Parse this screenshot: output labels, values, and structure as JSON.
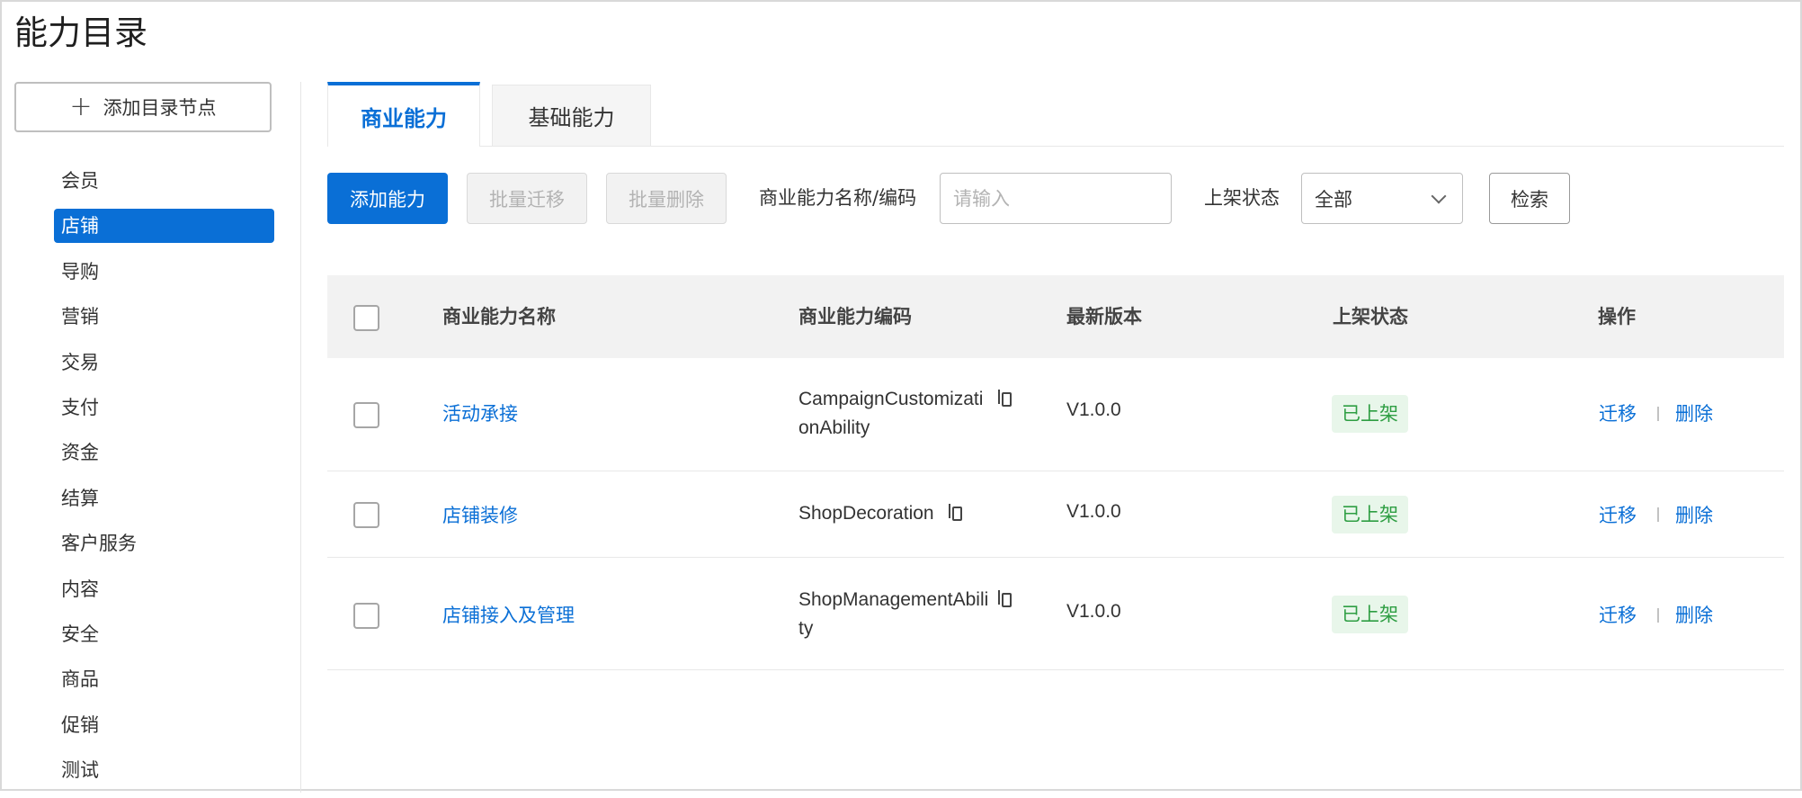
{
  "page": {
    "title": "能力目录"
  },
  "sidebar": {
    "add_node_label": "添加目录节点",
    "items": [
      {
        "label": "会员"
      },
      {
        "label": "店铺",
        "active": true
      },
      {
        "label": "导购"
      },
      {
        "label": "营销"
      },
      {
        "label": "交易"
      },
      {
        "label": "支付"
      },
      {
        "label": "资金"
      },
      {
        "label": "结算"
      },
      {
        "label": "客户服务"
      },
      {
        "label": "内容"
      },
      {
        "label": "安全"
      },
      {
        "label": "商品"
      },
      {
        "label": "促销"
      },
      {
        "label": "测试"
      }
    ]
  },
  "tabs": [
    {
      "label": "商业能力",
      "active": true
    },
    {
      "label": "基础能力",
      "active": false
    }
  ],
  "toolbar": {
    "add_label": "添加能力",
    "migrate_label": "批量迁移",
    "delete_label": "批量删除",
    "name_filter_label": "商业能力名称/编码",
    "name_filter_placeholder": "请输入",
    "status_filter_label": "上架状态",
    "status_filter_value": "全部",
    "search_label": "检索"
  },
  "table": {
    "columns": {
      "name": "商业能力名称",
      "code": "商业能力编码",
      "version": "最新版本",
      "status": "上架状态",
      "actions": "操作"
    },
    "rows": [
      {
        "name": "活动承接",
        "code": "CampaignCustomizationAbility",
        "version": "V1.0.0",
        "status": "已上架",
        "migrate": "迁移",
        "delete": "删除"
      },
      {
        "name": "店铺装修",
        "code": "ShopDecoration",
        "version": "V1.0.0",
        "status": "已上架",
        "migrate": "迁移",
        "delete": "删除"
      },
      {
        "name": "店铺接入及管理",
        "code": "ShopManagementAbility",
        "version": "V1.0.0",
        "status": "已上架",
        "migrate": "迁移",
        "delete": "删除"
      }
    ]
  },
  "colors": {
    "accent": "#0a6fd6",
    "status_green": "#2e9e43",
    "status_green_bg": "#e8f6ea",
    "header_bg": "#f2f2f2"
  }
}
